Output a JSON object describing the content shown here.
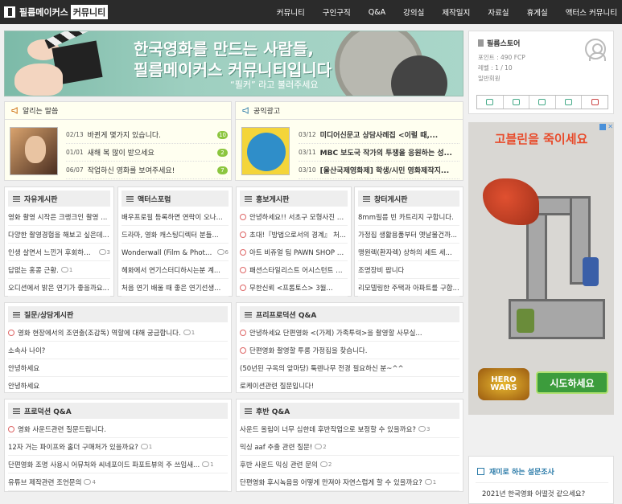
{
  "header": {
    "logo_text": "필름메이커스",
    "logo_badge": "커뮤니티",
    "nav": [
      "커뮤니티",
      "구인구직",
      "Q&A",
      "강의실",
      "제작일지",
      "자료실",
      "휴게실",
      "액터스 커뮤니티"
    ]
  },
  "banner": {
    "line1": "한국영화를 만드는 사람들,",
    "line2": "필름메이커스 커뮤니티입니다",
    "line3": "“필커” 라고 불러주세요"
  },
  "notice": {
    "title": "알리는 말씀",
    "items": [
      {
        "date": "02/13",
        "text": "바뀐게 몇가지 있습니다.",
        "count": "10"
      },
      {
        "date": "01/01",
        "text": "새해 복 많이 받으세요",
        "count": "2"
      },
      {
        "date": "06/07",
        "text": "작업하신 영화를 보여주세요!",
        "count": "7"
      }
    ]
  },
  "public_ad": {
    "title": "공익광고",
    "items": [
      {
        "date": "03/12",
        "text": "미디어신문고 상담사례집 <이럴 때,..."
      },
      {
        "date": "03/11",
        "text": "MBC 보도국 작가의 투쟁을 응원하는 성..."
      },
      {
        "date": "03/10",
        "text": "[울산국제영화제] 학생/시민 영화제작지..."
      }
    ]
  },
  "boards": {
    "free": {
      "title": "자유게시판",
      "items": [
        {
          "text": "영화 촬영 시작은 크랭크인 촬영 ...",
          "cm": ""
        },
        {
          "text": "다양한 촬영경험을 해보고 싶은데...",
          "cm": ""
        },
        {
          "text": "인생 살면서 느낀거 후회하는거!",
          "cm": "3"
        },
        {
          "text": "답없는 홍콩 근황.",
          "cm": "1"
        },
        {
          "text": "오디션에서 밝은 연기가 좋을까요...",
          "cm": ""
        }
      ]
    },
    "actors": {
      "title": "액터스포럼",
      "items": [
        {
          "text": "배우프로필 등록하면 연락이 오나...",
          "cm": ""
        },
        {
          "text": "드라마, 영화 캐스팅디렉터 분들...",
          "cm": ""
        },
        {
          "text": "Wonderwall (Film & Photo 클...",
          "cm": "6"
        },
        {
          "text": "헤화에서 연기스터디하시는분 계...",
          "cm": ""
        },
        {
          "text": "처음 연기 배울 때 좋은 연기선생...",
          "cm": ""
        }
      ]
    },
    "promo": {
      "title": "홍보게시판",
      "items": [
        {
          "text": "안녕하세요!! 서초구 모형사진 전문...",
          "clock": true
        },
        {
          "text": "초대!『방법으로서의 경계』 처...",
          "clock": true
        },
        {
          "text": "아트 비쥬얼 팀 PAWN SHOP SER...",
          "clock": true
        },
        {
          "text": "패션스타일리스트 어시스턴트 처...",
          "clock": true
        },
        {
          "text": "무한신뢰 <프롭토스> 3월...",
          "clock": true
        }
      ]
    },
    "warehouse": {
      "title": "창터게시판",
      "items": [
        {
          "text": "8mm필름 빈 카트리지 구합니다.",
          "cm": ""
        },
        {
          "text": "가정집 생활용품부터 옛날물건까...",
          "cm": ""
        },
        {
          "text": "맹원렉(환자렉) 상하의 세트 세...",
          "cm": ""
        },
        {
          "text": "조명장비 팝니다",
          "cm": ""
        },
        {
          "text": "리모델링한 주택과 아파트를 구합...",
          "cm": ""
        }
      ]
    },
    "qna": {
      "title": "질문/상담게시판",
      "items": [
        {
          "text": "영화 현장에서의 조연출(조감독) 역할에 대해 궁금합니다.",
          "cm": "1",
          "clock": true
        },
        {
          "text": "소속사 나이?",
          "cm": "",
          "clock": false
        },
        {
          "text": "안녕하세요",
          "cm": "",
          "clock": false
        },
        {
          "text": "안녕하세요",
          "cm": "",
          "clock": false
        }
      ]
    },
    "freepro": {
      "title": "프리프로덕션 Q&A",
      "items": [
        {
          "text": "안녕하세요 단편영화 <(가제) 가족투력>을 촬영할 사무실...",
          "cm": "",
          "clock": true
        },
        {
          "text": "단편영화 촬영할 투룸 가정집을 찾습니다.",
          "cm": "",
          "clock": true
        },
        {
          "text": "(50년된 구옥의 앞마당) 툭렌나무 전경 필요하신 분~^^",
          "cm": "",
          "clock": false
        },
        {
          "text": "로케이션관련 질문입니다!",
          "cm": "",
          "clock": false
        }
      ]
    },
    "production": {
      "title": "프로덕션 Q&A",
      "items": [
        {
          "text": "영화 사운드관련 질문드립니다.",
          "cm": "",
          "clock": true
        },
        {
          "text": "12자 거는 파이프와 홀더 구매처가 있을까요?",
          "cm": "1",
          "clock": false
        },
        {
          "text": "단편영화 조명 사용시 어뮤처와 씨네포이드 파포트뷰의 주 쓰임새...",
          "cm": "1",
          "clock": false
        },
        {
          "text": "유튜브 제작관련 조언문의",
          "cm": "4",
          "clock": false
        }
      ]
    },
    "post": {
      "title": "후반 Q&A",
      "items": [
        {
          "text": "사운드 올림이 너무 심한데 후반작업으로 보정할 수 있을까요?",
          "cm": "3",
          "clock": false
        },
        {
          "text": "믹싱 aaf 추출 관련 질문!",
          "cm": "2",
          "clock": false
        },
        {
          "text": "후반 사운드 믹싱 관련 문의",
          "cm": "2",
          "clock": false
        },
        {
          "text": "단편영화 후시녹음을 어떻게 만져야 자연스럽게 할 수 있을까요?",
          "cm": "1",
          "clock": false
        }
      ]
    }
  },
  "profile": {
    "name": "필름스토어",
    "points": "포인트 : 490 FCP",
    "level": "레벨 : 1 / 10",
    "role": "일반회원"
  },
  "game_ad": {
    "headline": "고블린을 죽이세요",
    "badge_line1": "HERO",
    "badge_line2": "WARS",
    "cta": "시도하세요"
  },
  "poll": {
    "title": "재미로 하는 설문조사",
    "question": "2021년 한국영화 어떨것 같으세요?"
  },
  "colors": {
    "topbar": "#2b2b2b",
    "accent_green": "#8cc63f",
    "notice_bg": "#fffff0",
    "ad_red": "#e84a2a"
  }
}
